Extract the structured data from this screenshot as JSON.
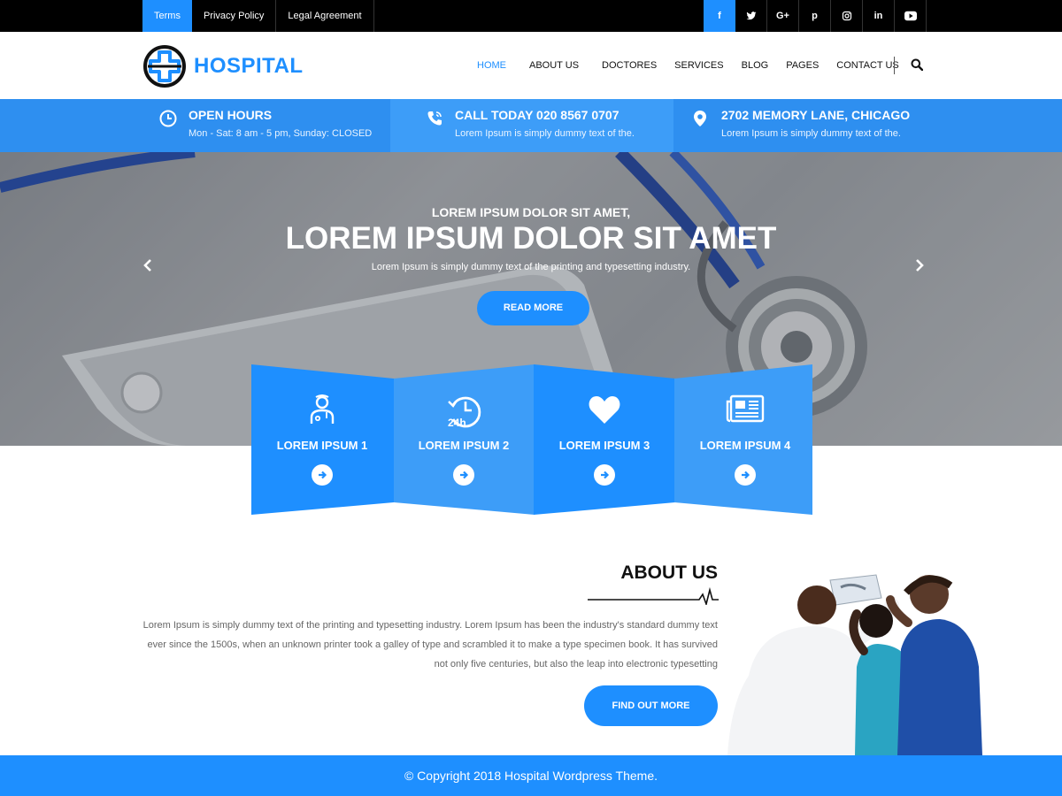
{
  "topbar": {
    "links": [
      {
        "label": "Terms"
      },
      {
        "label": "Privacy Policy"
      },
      {
        "label": "Legal Agreement"
      }
    ],
    "social": [
      {
        "icon": "facebook-icon",
        "glyph": "f"
      },
      {
        "icon": "twitter-icon",
        "glyph": "t"
      },
      {
        "icon": "google-plus-icon",
        "glyph": "G+"
      },
      {
        "icon": "pinterest-icon",
        "glyph": "p"
      },
      {
        "icon": "instagram-icon",
        "glyph": "o"
      },
      {
        "icon": "linkedin-icon",
        "glyph": "in"
      },
      {
        "icon": "youtube-icon",
        "glyph": "▶"
      }
    ]
  },
  "header": {
    "logo_text": "HOSPITAL",
    "nav": [
      {
        "label": "HOME"
      },
      {
        "label": "ABOUT US"
      },
      {
        "label": "DOCTORES"
      },
      {
        "label": "SERVICES"
      },
      {
        "label": "BLOG"
      },
      {
        "label": "PAGES"
      },
      {
        "label": "CONTACT US"
      }
    ],
    "search_icon": "search-icon"
  },
  "infobar": {
    "items": [
      {
        "icon": "clock-icon",
        "title": "OPEN HOURS",
        "subtitle": "Mon - Sat: 8 am - 5 pm, Sunday: CLOSED"
      },
      {
        "icon": "phone-icon",
        "title": "CALL TODAY 020 8567 0707",
        "subtitle": "Lorem Ipsum is simply dummy text of the."
      },
      {
        "icon": "location-pin-icon",
        "title": "2702 MEMORY LANE, CHICAGO",
        "subtitle": "Lorem Ipsum is simply dummy text of the."
      }
    ]
  },
  "hero": {
    "subtitle": "LOREM IPSUM DOLOR SIT AMET,",
    "title": "LOREM IPSUM DOLOR SIT AMET",
    "description": "Lorem Ipsum is simply dummy text of the printing and typesetting industry.",
    "button_label": "READ MORE"
  },
  "features": [
    {
      "icon": "doctor-icon",
      "label": "LOREM IPSUM 1"
    },
    {
      "icon": "24h-clock-icon",
      "label": "LOREM IPSUM 2"
    },
    {
      "icon": "heart-icon",
      "label": "LOREM IPSUM 3"
    },
    {
      "icon": "newspaper-icon",
      "label": "LOREM IPSUM 4"
    }
  ],
  "about": {
    "title": "ABOUT US",
    "text": "Lorem Ipsum is simply dummy text of the printing and typesetting industry. Lorem Ipsum has been the industry's standard dummy text ever since the 1500s, when an unknown printer took a galley of type and scrambled it to make a type specimen book. It has survived not only five centuries, but also the leap into electronic typesetting",
    "button_label": "FIND OUT MORE"
  },
  "footer": {
    "copyright": "© Copyright 2018 Hospital Wordpress Theme."
  },
  "colors": {
    "accent": "#1e8fff",
    "infobar": "#2e8ff0",
    "topbar": "#000000"
  }
}
